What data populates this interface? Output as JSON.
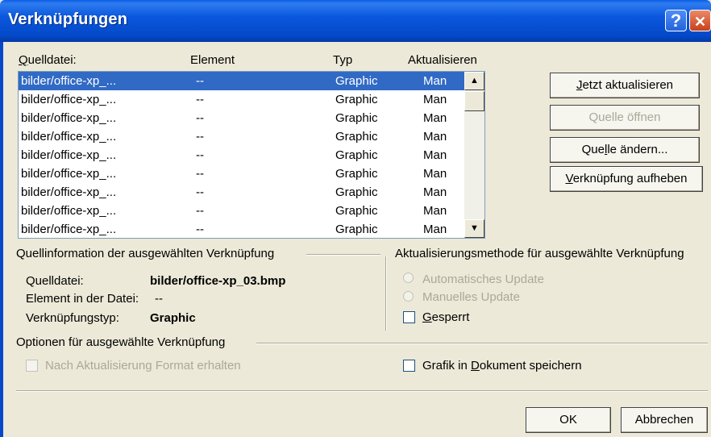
{
  "window": {
    "title": "Verknüpfungen",
    "help": "?",
    "close": "✕"
  },
  "columns": {
    "source": "Quelldatei:",
    "element": "Element",
    "type": "Typ",
    "update": "Aktualisieren"
  },
  "links": [
    {
      "source": "bilder/office-xp_...",
      "element": "--",
      "type": "Graphic",
      "update": "Man"
    },
    {
      "source": "bilder/office-xp_...",
      "element": "--",
      "type": "Graphic",
      "update": "Man"
    },
    {
      "source": "bilder/office-xp_...",
      "element": "--",
      "type": "Graphic",
      "update": "Man"
    },
    {
      "source": "bilder/office-xp_...",
      "element": "--",
      "type": "Graphic",
      "update": "Man"
    },
    {
      "source": "bilder/office-xp_...",
      "element": "--",
      "type": "Graphic",
      "update": "Man"
    },
    {
      "source": "bilder/office-xp_...",
      "element": "--",
      "type": "Graphic",
      "update": "Man"
    },
    {
      "source": "bilder/office-xp_...",
      "element": "--",
      "type": "Graphic",
      "update": "Man"
    },
    {
      "source": "bilder/office-xp_...",
      "element": "--",
      "type": "Graphic",
      "update": "Man"
    },
    {
      "source": "bilder/office-xp_...",
      "element": "--",
      "type": "Graphic",
      "update": "Man"
    }
  ],
  "buttons": {
    "update_now": {
      "u": "J",
      "rest": "etzt aktualisieren"
    },
    "open_source": "Quelle öffnen",
    "change_source": {
      "pre": "Que",
      "u": "l",
      "rest": "le ändern..."
    },
    "break_link": {
      "u": "V",
      "rest": "erknüpfung aufheben"
    },
    "ok": "OK",
    "cancel": "Abbrechen"
  },
  "source_info": {
    "heading": "Quellinformation der ausgewählten Verknüpfung",
    "file_label": "Quelldatei:",
    "file_value": "bilder/office-xp_03.bmp",
    "element_label": "Element in der Datei:",
    "element_value": "--",
    "type_label": "Verknüpfungstyp:",
    "type_value": "Graphic"
  },
  "update_method": {
    "heading": "Aktualisierungsmethode für ausgewählte Verknüpfung",
    "automatic": "Automatisches Update",
    "manual": "Manuelles Update",
    "locked": {
      "u": "G",
      "rest": "esperrt"
    }
  },
  "options": {
    "heading": "Optionen für ausgewählte Verknüpfung",
    "keep_format": "Nach Aktualisierung Format erhalten",
    "save_graphic": {
      "pre": "Grafik in ",
      "u": "D",
      "rest": "okument speichern"
    }
  }
}
